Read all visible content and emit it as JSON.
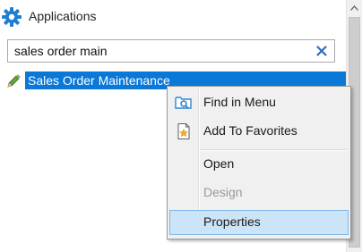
{
  "panel": {
    "title": "Applications",
    "icon": "gear-icon",
    "accent_color": "#1e7fd0"
  },
  "search": {
    "value": "sales order main",
    "clear_icon": "clear-icon",
    "clear_color": "#2d6cc2"
  },
  "results": [
    {
      "label": "Sales Order Maintenance",
      "icon": "pencil-icon",
      "selected": true,
      "selected_color": "#0a78d7"
    }
  ],
  "context_menu": {
    "items": [
      {
        "label": "Find in Menu",
        "icon": "folder-search-icon",
        "enabled": true,
        "highlighted": false
      },
      {
        "label": "Add To Favorites",
        "icon": "favorite-add-icon",
        "enabled": true,
        "highlighted": false
      },
      {
        "label": "Open",
        "icon": "",
        "enabled": true,
        "highlighted": false
      },
      {
        "label": "Design",
        "icon": "",
        "enabled": false,
        "highlighted": false
      },
      {
        "label": "Properties",
        "icon": "",
        "enabled": true,
        "highlighted": true
      }
    ],
    "highlight_color": "#cce4f7"
  }
}
